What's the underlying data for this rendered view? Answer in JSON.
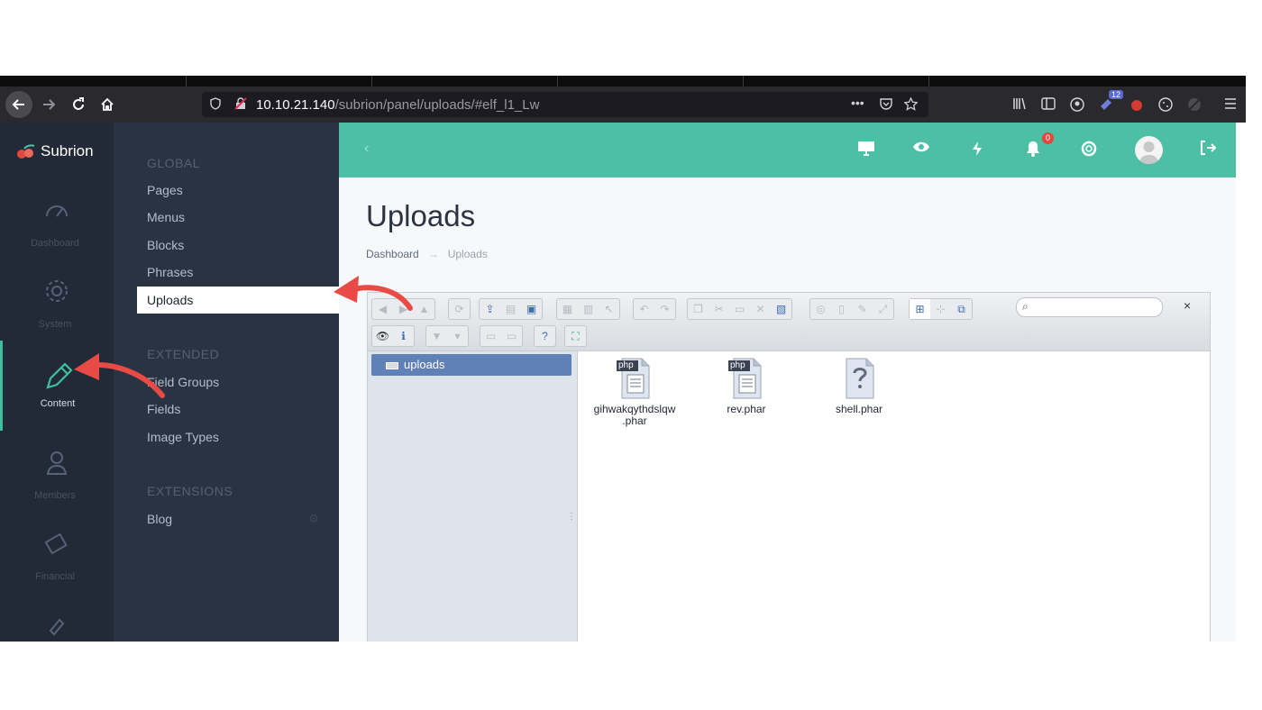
{
  "browser": {
    "url_host": "10.10.21.140",
    "url_path": "/subrion/panel/uploads/#elf_l1_Lw",
    "extensions_badge": "12",
    "menu_dots": "•••"
  },
  "app": {
    "brand": "Subrion",
    "rail": [
      {
        "label": "Dashboard",
        "icon": "dashboard-icon"
      },
      {
        "label": "System",
        "icon": "gear-icon"
      },
      {
        "label": "Content",
        "icon": "pencil-icon"
      },
      {
        "label": "Members",
        "icon": "user-icon"
      },
      {
        "label": "Financial",
        "icon": "wallet-icon"
      }
    ],
    "subnav": {
      "global_heading": "GLOBAL",
      "global_items": [
        "Pages",
        "Menus",
        "Blocks",
        "Phrases",
        "Uploads"
      ],
      "extended_heading": "EXTENDED",
      "extended_items": [
        "Field Groups",
        "Fields",
        "Image Types"
      ],
      "extensions_heading": "EXTENSIONS",
      "extensions_items": [
        "Blog"
      ]
    },
    "topbar": {
      "collapse_icon": "‹",
      "notification_count": "0"
    },
    "page": {
      "title": "Uploads",
      "breadcrumb_home": "Dashboard",
      "breadcrumb_arrow": "→",
      "breadcrumb_current": "Uploads"
    },
    "filemanager": {
      "tree_root": "uploads",
      "search_icon": "⌕",
      "close": "×",
      "files": [
        {
          "name": "gihwakqythdslqw .phar",
          "type_label": "php",
          "kind": "php"
        },
        {
          "name": "rev.phar",
          "type_label": "php",
          "kind": "php"
        },
        {
          "name": "shell.phar",
          "type_label": "",
          "kind": "unknown"
        }
      ]
    }
  },
  "colors": {
    "accent": "#4dbfa4",
    "sidebar": "#222a37",
    "subnav": "#2a3342",
    "annotation_arrow": "#e84a45"
  }
}
